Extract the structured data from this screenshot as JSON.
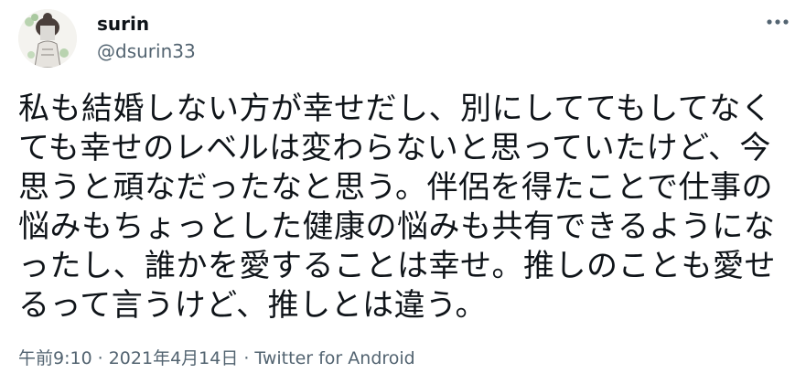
{
  "author": {
    "display_name": "surin",
    "handle": "@dsurin33",
    "avatar_icon": "avatar-illustration"
  },
  "more_icon": "more-options-icon",
  "tweet": {
    "lines": [
      "私も結婚しない方が幸せだし、別にしててもしてなく",
      "ても幸せのレベルは変わらないと思っていたけど、今",
      "思うと頑なだったなと思う。伴侶を得たことで仕事の",
      "悩みもちょっとした健康の悩みも共有できるようにな",
      "ったし、誰かを愛することは幸せ。推しのことも愛せ",
      "るって言うけど、推しとは違う。"
    ]
  },
  "meta": {
    "time": "午前9:10",
    "separator": "·",
    "date": "2021年4月14日",
    "source": "Twitter for Android"
  },
  "colors": {
    "text": "#0f1419",
    "secondary": "#536471"
  }
}
